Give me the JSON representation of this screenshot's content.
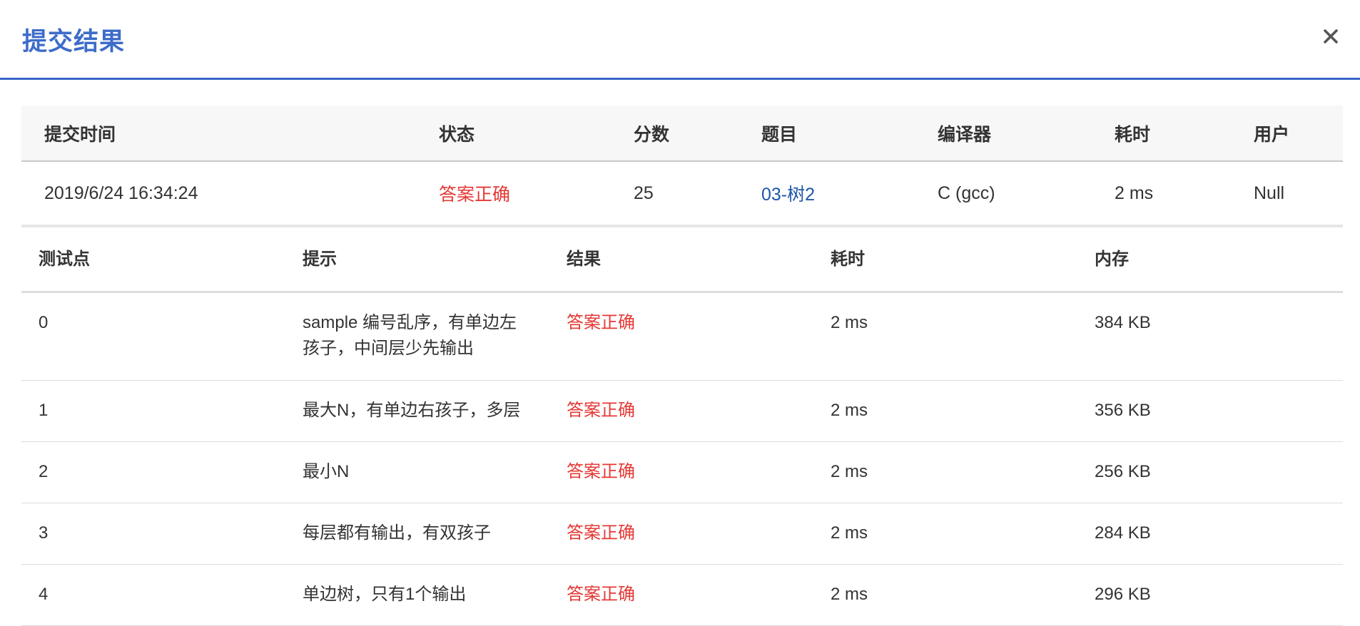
{
  "dialog": {
    "title": "提交结果",
    "close_icon": "close-icon"
  },
  "summary": {
    "headers": [
      "提交时间",
      "状态",
      "分数",
      "题目",
      "编译器",
      "耗时",
      "用户"
    ],
    "row": {
      "time": "2019/6/24 16:34:24",
      "status": "答案正确",
      "score": "25",
      "problem": "03-树2",
      "compiler": "C (gcc)",
      "elapsed": "2 ms",
      "user": "Null"
    }
  },
  "cases": {
    "headers": [
      "测试点",
      "提示",
      "结果",
      "耗时",
      "内存"
    ],
    "rows": [
      {
        "id": "0",
        "tip": "sample 编号乱序，有单边左孩子，中间层少先输出",
        "result": "答案正确",
        "time": "2 ms",
        "memory": "384 KB"
      },
      {
        "id": "1",
        "tip": "最大N，有单边右孩子，多层",
        "result": "答案正确",
        "time": "2 ms",
        "memory": "356 KB"
      },
      {
        "id": "2",
        "tip": "最小N",
        "result": "答案正确",
        "time": "2 ms",
        "memory": "256 KB"
      },
      {
        "id": "3",
        "tip": "每层都有输出，有双孩子",
        "result": "答案正确",
        "time": "2 ms",
        "memory": "284 KB"
      },
      {
        "id": "4",
        "tip": "单边树，只有1个输出",
        "result": "答案正确",
        "time": "2 ms",
        "memory": "296 KB"
      }
    ]
  },
  "colors": {
    "accent": "#3d6cc9",
    "success_text": "#e53935",
    "link": "#1f56a8"
  }
}
